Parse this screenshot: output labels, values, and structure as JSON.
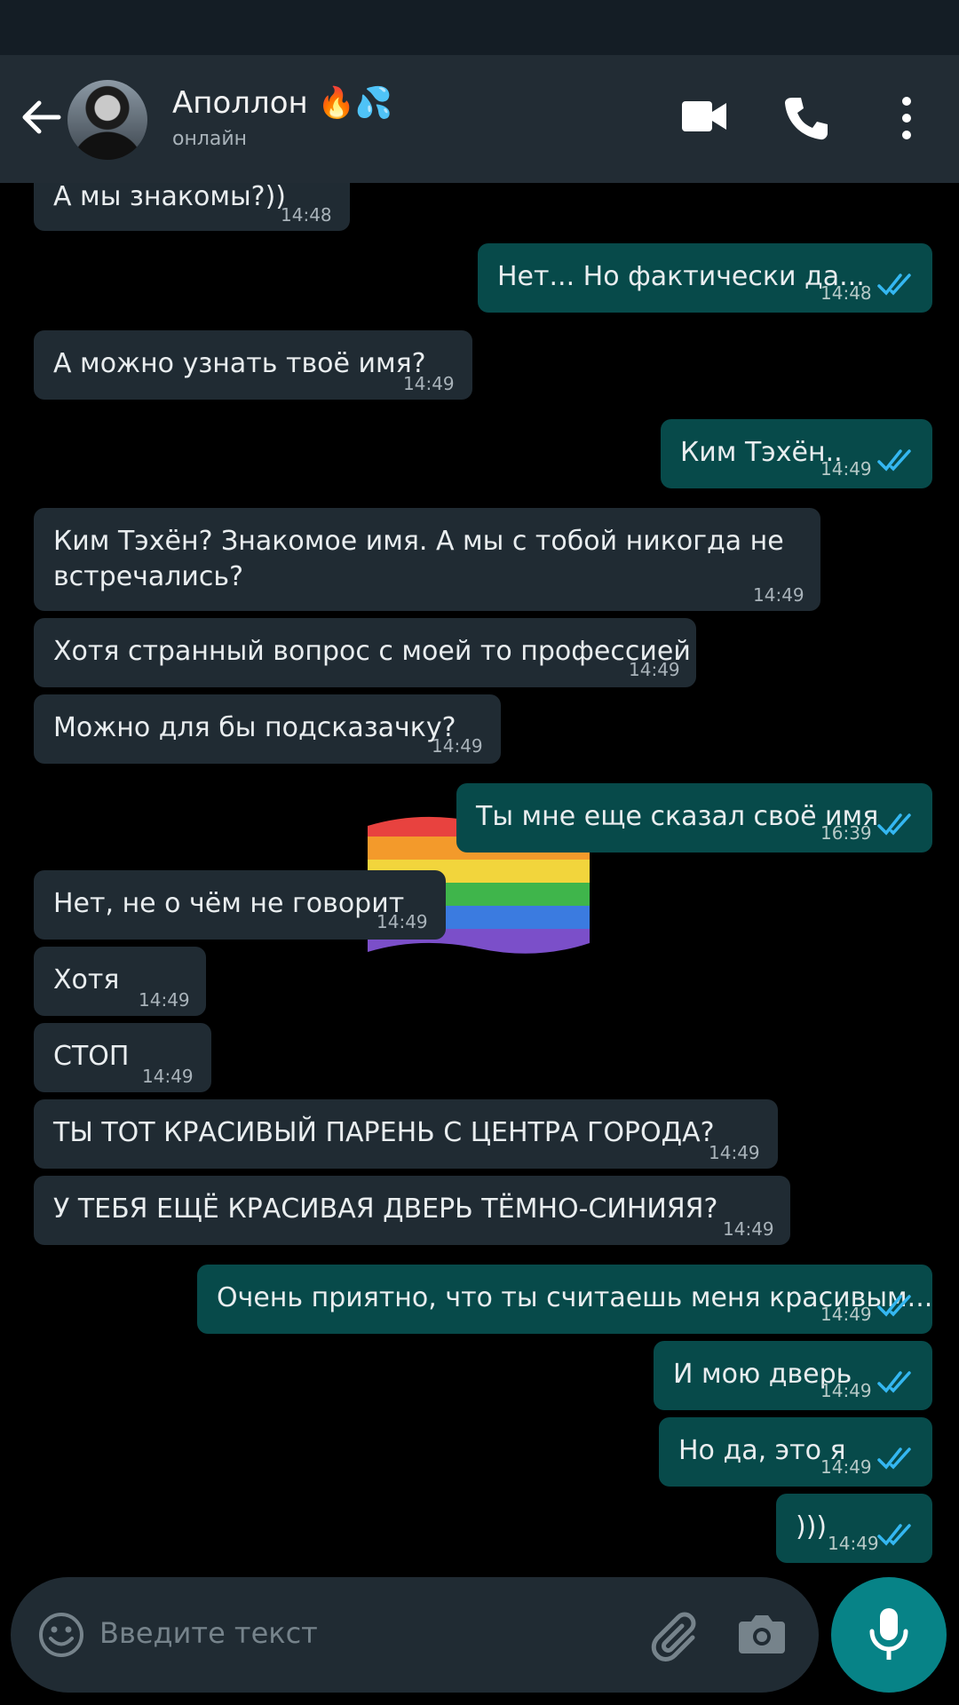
{
  "header": {
    "contact_name": "Аполлон 🔥💦",
    "contact_status": "онлайн"
  },
  "messages": [
    {
      "direction": "in",
      "text": "А мы знакомы?))",
      "time": "14:48"
    },
    {
      "direction": "out",
      "text": "Нет... Но фактически да...",
      "time": "14:48"
    },
    {
      "direction": "in",
      "text": "А можно узнать твоё имя?",
      "time": "14:49"
    },
    {
      "direction": "out",
      "text": "Ким Тэхён..",
      "time": "14:49"
    },
    {
      "direction": "in",
      "text_line1": "Ким Тэхён? Знакомое имя. А мы с тобой никогда не",
      "text_line2": "встречались?",
      "time": "14:49"
    },
    {
      "direction": "in",
      "text": "Хотя странный вопрос с моей то профессией",
      "time": "14:49"
    },
    {
      "direction": "in",
      "text": "Можно для бы подсказачку?",
      "time": "14:49"
    },
    {
      "direction": "out",
      "text": "Ты мне еще сказал своё имя",
      "time": "16:39"
    },
    {
      "direction": "in",
      "text": "Нет, не о чём не говорит",
      "time": "14:49"
    },
    {
      "direction": "in",
      "text": "Хотя",
      "time": "14:49"
    },
    {
      "direction": "in",
      "text": "СТОП",
      "time": "14:49"
    },
    {
      "direction": "in",
      "text": "ТЫ ТОТ КРАСИВЫЙ ПАРЕНЬ С ЦЕНТРА ГОРОДА?",
      "time": "14:49"
    },
    {
      "direction": "in",
      "text": "У ТЕБЯ ЕЩЁ КРАСИВАЯ ДВЕРЬ ТЁМНО-СИНИЯЯ?",
      "time": "14:49"
    },
    {
      "direction": "out",
      "text": "Очень приятно, что ты считаешь меня красивым...",
      "time": "14:49"
    },
    {
      "direction": "out",
      "text": "И мою дверь",
      "time": "14:49"
    },
    {
      "direction": "out",
      "text": "Но да, это я",
      "time": "14:49"
    },
    {
      "direction": "out",
      "text": ")))",
      "time": "14:49"
    }
  ],
  "input": {
    "placeholder": "Введите текст"
  },
  "colors": {
    "header_bg": "#222c34",
    "incoming_bubble": "#202b33",
    "outgoing_bubble": "#074a4a",
    "read_ticks": "#34b7f1",
    "mic_button": "#078387"
  },
  "icons": [
    "back-arrow-icon",
    "video-call-icon",
    "phone-icon",
    "more-vert-icon",
    "emoji-icon",
    "attach-icon",
    "camera-icon",
    "mic-icon",
    "double-check-icon",
    "rainbow-flag-sticker"
  ]
}
